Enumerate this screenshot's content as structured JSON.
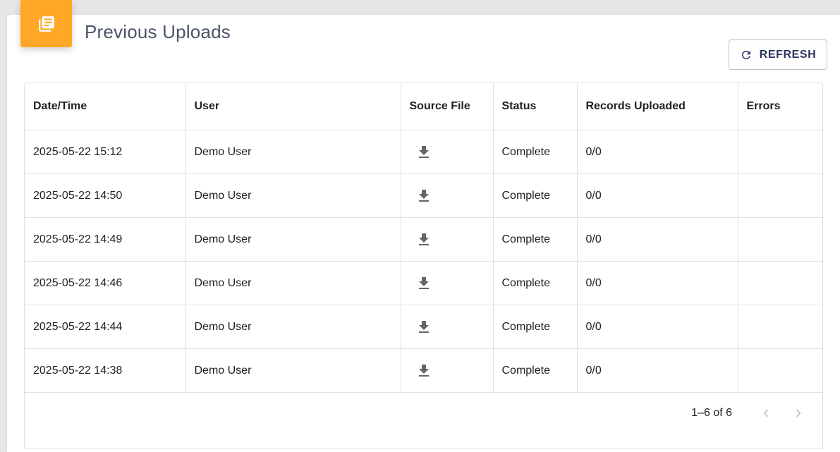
{
  "header": {
    "title": "Previous Uploads",
    "icon": "library-books-icon",
    "accent_color": "#ffa726"
  },
  "toolbar": {
    "refresh_label": "REFRESH",
    "refresh_icon": "refresh-icon"
  },
  "table": {
    "columns": [
      "Date/Time",
      "User",
      "Source File",
      "Status",
      "Records Uploaded",
      "Errors"
    ],
    "rows": [
      {
        "datetime": "2025-05-22 15:12",
        "user": "Demo User",
        "source_file_icon": "download-icon",
        "status": "Complete",
        "records": "0/0",
        "errors": ""
      },
      {
        "datetime": "2025-05-22 14:50",
        "user": "Demo User",
        "source_file_icon": "download-icon",
        "status": "Complete",
        "records": "0/0",
        "errors": ""
      },
      {
        "datetime": "2025-05-22 14:49",
        "user": "Demo User",
        "source_file_icon": "download-icon",
        "status": "Complete",
        "records": "0/0",
        "errors": ""
      },
      {
        "datetime": "2025-05-22 14:46",
        "user": "Demo User",
        "source_file_icon": "download-icon",
        "status": "Complete",
        "records": "0/0",
        "errors": ""
      },
      {
        "datetime": "2025-05-22 14:44",
        "user": "Demo User",
        "source_file_icon": "download-icon",
        "status": "Complete",
        "records": "0/0",
        "errors": ""
      },
      {
        "datetime": "2025-05-22 14:38",
        "user": "Demo User",
        "source_file_icon": "download-icon",
        "status": "Complete",
        "records": "0/0",
        "errors": ""
      }
    ]
  },
  "pagination": {
    "range_text": "1–6 of 6",
    "prev_icon": "chevron-left-icon",
    "next_icon": "chevron-right-icon"
  }
}
